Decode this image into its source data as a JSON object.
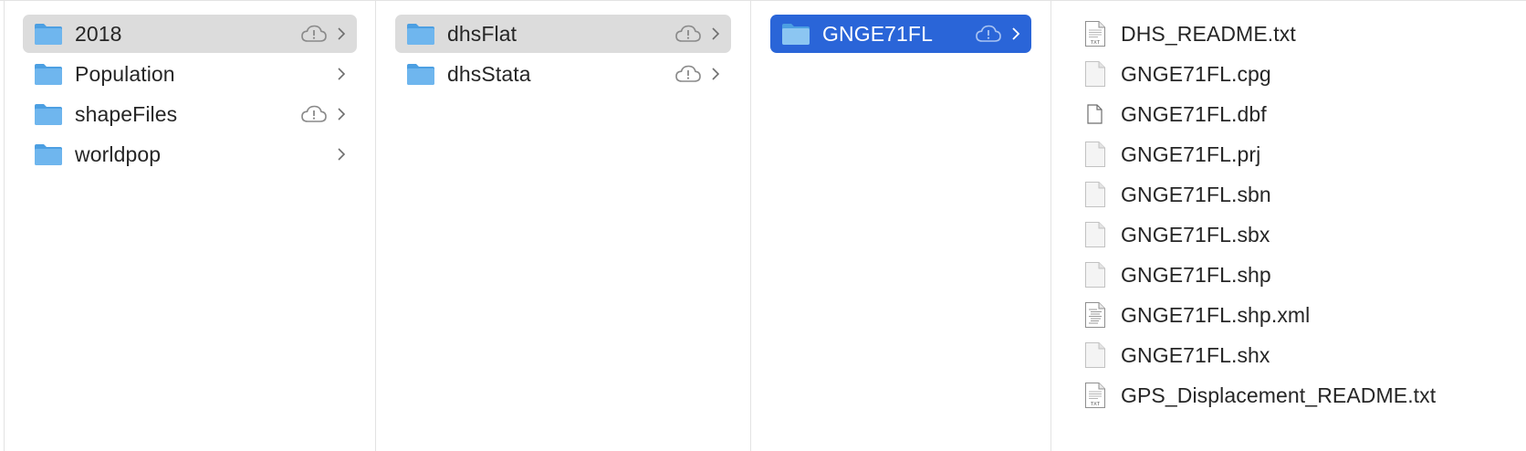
{
  "columns": [
    {
      "items": [
        {
          "label": "2018",
          "state": "selected-inactive",
          "cloud": true,
          "chevron": true
        },
        {
          "label": "Population",
          "state": "",
          "cloud": false,
          "chevron": true
        },
        {
          "label": "shapeFiles",
          "state": "",
          "cloud": true,
          "chevron": true
        },
        {
          "label": "worldpop",
          "state": "",
          "cloud": false,
          "chevron": true
        }
      ]
    },
    {
      "items": [
        {
          "label": "dhsFlat",
          "state": "selected-inactive",
          "cloud": true,
          "chevron": true
        },
        {
          "label": "dhsStata",
          "state": "",
          "cloud": true,
          "chevron": true
        }
      ]
    },
    {
      "items": [
        {
          "label": "GNGE71FL",
          "state": "selected-active",
          "cloud": true,
          "chevron": true
        }
      ]
    },
    {
      "files": [
        {
          "label": "DHS_README.txt",
          "icon": "txt-file-icon"
        },
        {
          "label": "GNGE71FL.cpg",
          "icon": "blank-file-icon"
        },
        {
          "label": "GNGE71FL.dbf",
          "icon": "document-file-icon"
        },
        {
          "label": "GNGE71FL.prj",
          "icon": "blank-file-icon"
        },
        {
          "label": "GNGE71FL.sbn",
          "icon": "blank-file-icon"
        },
        {
          "label": "GNGE71FL.sbx",
          "icon": "blank-file-icon"
        },
        {
          "label": "GNGE71FL.shp",
          "icon": "blank-file-icon"
        },
        {
          "label": "GNGE71FL.shp.xml",
          "icon": "xml-file-icon"
        },
        {
          "label": "GNGE71FL.shx",
          "icon": "blank-file-icon"
        },
        {
          "label": "GPS_Displacement_README.txt",
          "icon": "txt-file-icon"
        }
      ]
    }
  ],
  "colors": {
    "folder_fill": "#6fb6ee",
    "folder_tab": "#4c9fe2",
    "selection_active": "#2a65d8",
    "selection_inactive": "#dcdcdc",
    "icon_gray": "#8a8a8a"
  }
}
